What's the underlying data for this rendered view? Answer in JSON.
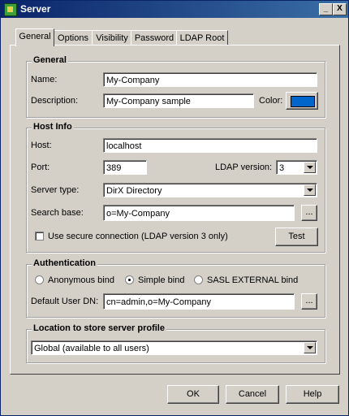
{
  "window": {
    "title": "Server",
    "minimize": "_",
    "close": "X"
  },
  "tabs": [
    {
      "label": "General"
    },
    {
      "label": "Options"
    },
    {
      "label": "Visibility"
    },
    {
      "label": "Password"
    },
    {
      "label": "LDAP Root"
    }
  ],
  "general": {
    "title": "General",
    "name_label": "Name:",
    "name_value": "My-Company",
    "description_label": "Description:",
    "description_value": "My-Company sample",
    "color_label": "Color:",
    "color_value": "#0066cc"
  },
  "host": {
    "title": "Host Info",
    "host_label": "Host:",
    "host_value": "localhost",
    "port_label": "Port:",
    "port_value": "389",
    "ldap_version_label": "LDAP version:",
    "ldap_version_value": "3",
    "server_type_label": "Server type:",
    "server_type_value": "DirX Directory",
    "search_base_label": "Search base:",
    "search_base_value": "o=My-Company",
    "browse_label": "...",
    "secure_label": "Use secure connection (LDAP version 3 only)",
    "secure_checked": false,
    "test_label": "Test"
  },
  "auth": {
    "title": "Authentication",
    "anonymous_label": "Anonymous bind",
    "simple_label": "Simple bind",
    "sasl_label": "SASL EXTERNAL bind",
    "selected": "simple",
    "default_dn_label": "Default User DN:",
    "default_dn_value": "cn=admin,o=My-Company",
    "browse_label": "..."
  },
  "location": {
    "title": "Location to store server profile",
    "value": "Global (available to all users)"
  },
  "buttons": {
    "ok": "OK",
    "cancel": "Cancel",
    "help": "Help"
  }
}
